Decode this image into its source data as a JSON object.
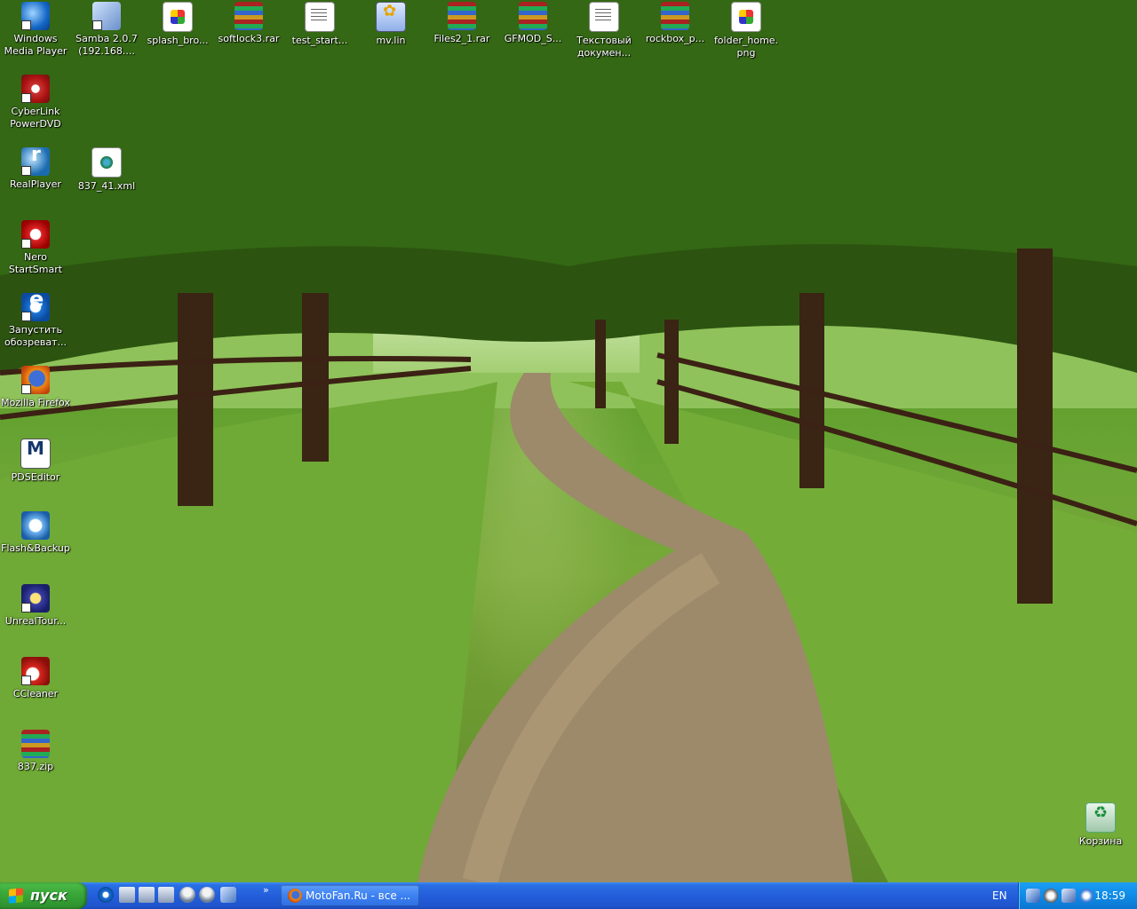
{
  "desktop": {
    "icons": [
      {
        "label": "Windows\nMedia Player",
        "icon": "windows-media-player-icon"
      },
      {
        "label": "Samba 2.0.7\n(192.168....",
        "icon": "network-drive-icon"
      },
      {
        "label": "splash_bro...",
        "icon": "png-image-icon"
      },
      {
        "label": "softlock3.rar",
        "icon": "winrar-archive-icon"
      },
      {
        "label": "test_start...",
        "icon": "text-file-icon"
      },
      {
        "label": "mv.lin",
        "icon": "lin-file-icon"
      },
      {
        "label": "Files2_1.rar",
        "icon": "winrar-archive-icon"
      },
      {
        "label": "GFMOD_S...",
        "icon": "winrar-archive-icon"
      },
      {
        "label": "Текстовый\nдокумен...",
        "icon": "text-file-icon"
      },
      {
        "label": "rockbox_p...",
        "icon": "winrar-archive-icon"
      },
      {
        "label": "folder_home.\npng",
        "icon": "png-image-icon"
      },
      {
        "label": "CyberLink\nPowerDVD",
        "icon": "powerdvd-icon"
      },
      {
        "label": "RealPlayer",
        "icon": "realplayer-icon"
      },
      {
        "label": "837_41.xml",
        "icon": "xml-file-icon"
      },
      {
        "label": "Nero\nStartSmart",
        "icon": "nero-icon"
      },
      {
        "label": "Запустить\nобозреват...",
        "icon": "internet-explorer-icon"
      },
      {
        "label": "Mozilla Firefox",
        "icon": "firefox-icon"
      },
      {
        "label": "PDSEditor",
        "icon": "motorola-icon"
      },
      {
        "label": "Flash&Backup",
        "icon": "flash-backup-icon"
      },
      {
        "label": "UnrealTour...",
        "icon": "unreal-tournament-icon"
      },
      {
        "label": "CCleaner",
        "icon": "ccleaner-icon"
      },
      {
        "label": "837.zip",
        "icon": "winrar-archive-icon"
      },
      {
        "label": "Корзина",
        "icon": "recycle-bin-icon"
      }
    ]
  },
  "taskbar": {
    "start_label": "пуск",
    "quick_launch_chevron": "»",
    "window_button_label": "MotoFan.Ru - все ...",
    "language": "EN",
    "clock": "18:59"
  }
}
